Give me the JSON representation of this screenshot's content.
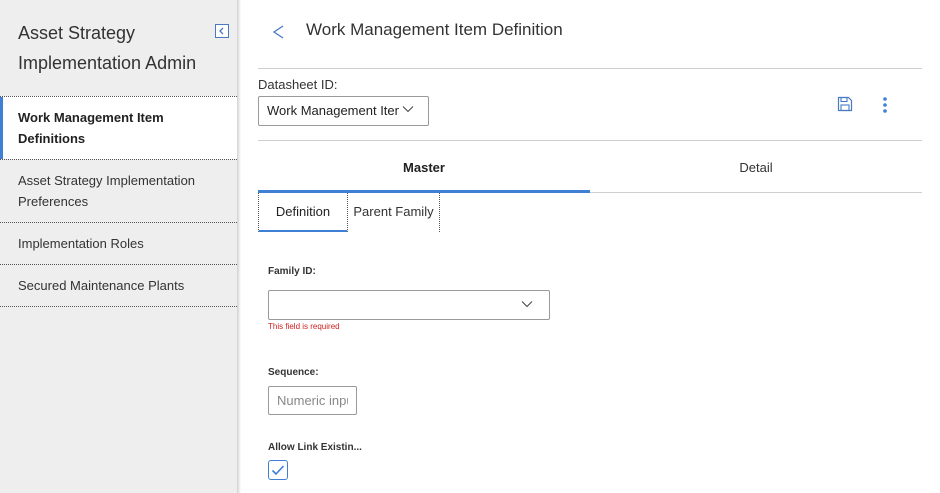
{
  "sidebar": {
    "title": "Asset Strategy Implementation Admin",
    "items": [
      {
        "label": "Work Management Item Definitions",
        "active": true
      },
      {
        "label": "Asset Strategy Implementation Preferences",
        "active": false
      },
      {
        "label": "Implementation Roles",
        "active": false
      },
      {
        "label": "Secured Maintenance Plants",
        "active": false
      }
    ]
  },
  "header": {
    "title": "Work Management Item Definition"
  },
  "datasheet": {
    "label": "Datasheet ID:",
    "value": "Work Management Item"
  },
  "tabs": [
    {
      "label": "Master",
      "active": true
    },
    {
      "label": "Detail",
      "active": false
    }
  ],
  "subtabs": [
    {
      "label": "Definition",
      "active": true
    },
    {
      "label": "Parent Family",
      "active": false
    }
  ],
  "form": {
    "family_id": {
      "label": "Family ID:",
      "value": "",
      "error": "This field is required"
    },
    "sequence": {
      "label": "Sequence:",
      "placeholder": "Numeric input"
    },
    "allow_link": {
      "label": "Allow Link Existin...",
      "checked": true
    }
  },
  "colors": {
    "accent": "#3f7fd4",
    "error": "#d32020",
    "sidebar_bg": "#eeeeee"
  }
}
